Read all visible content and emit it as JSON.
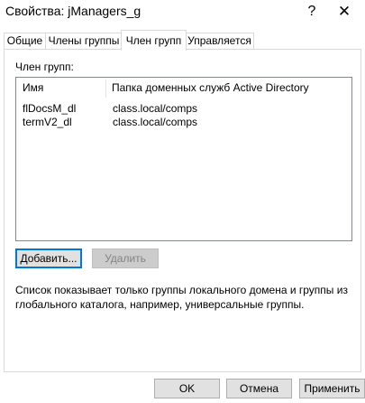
{
  "window": {
    "title": "Свойства: jManagers_g",
    "help_glyph": "?",
    "close_glyph": "✕"
  },
  "tabs": [
    {
      "label": "Общие",
      "active": false
    },
    {
      "label": "Члены группы",
      "active": false
    },
    {
      "label": "Член групп",
      "active": true
    },
    {
      "label": "Управляется",
      "active": false
    }
  ],
  "member_of": {
    "group_label": "Член групп:",
    "columns": {
      "name": "Имя",
      "folder": "Папка доменных служб Active Directory"
    },
    "rows": [
      {
        "name": "flDocsM_dl",
        "folder": "class.local/comps"
      },
      {
        "name": "termV2_dl",
        "folder": "class.local/comps"
      }
    ],
    "add_label": "Добавить...",
    "remove_label": "Удалить",
    "note": "Список показывает только группы локального домена и группы из глобального каталога, например, универсальные группы."
  },
  "footer": {
    "ok_label": "OK",
    "cancel_label": "Отмена",
    "apply_label": "Применить"
  },
  "colors": {
    "accent": "#0078d7",
    "button_face": "#e1e1e1",
    "disabled_text": "#838383"
  }
}
